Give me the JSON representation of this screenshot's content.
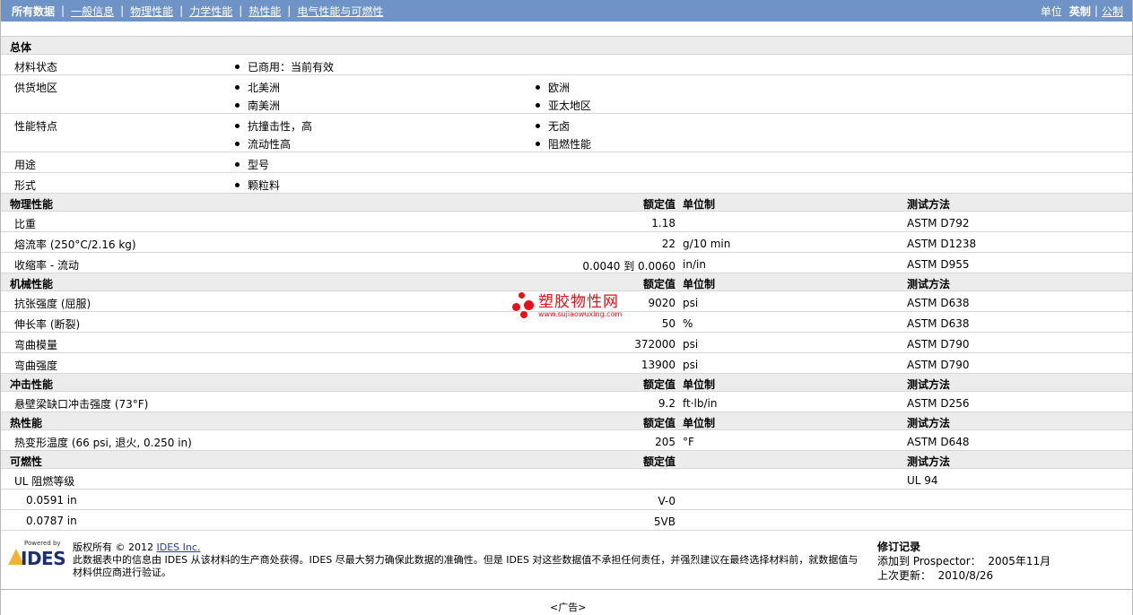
{
  "nav": {
    "tabs": [
      {
        "label": "所有数据",
        "active": true
      },
      {
        "label": "一般信息"
      },
      {
        "label": "物理性能"
      },
      {
        "label": "力学性能"
      },
      {
        "label": "热性能"
      },
      {
        "label": "电气性能与可燃性"
      }
    ],
    "units_label": "单位",
    "unit_current": "英制",
    "unit_other": "公制"
  },
  "general": {
    "title": "总体",
    "material_status_label": "材料状态",
    "material_status": "已商用：当前有效",
    "supply_label": "供货地区",
    "supply": [
      "北美洲",
      "欧洲",
      "南美洲",
      "亚太地区"
    ],
    "features_label": "性能特点",
    "features": [
      "抗撞击性，高",
      "无卤",
      "流动性高",
      "阻燃性能"
    ],
    "use_label": "用途",
    "use": "型号",
    "form_label": "形式",
    "form": "颗粒料"
  },
  "headers": {
    "rated": "额定值",
    "unit": "单位制",
    "test": "测试方法"
  },
  "sections": {
    "physical": {
      "title": "物理性能",
      "rows": [
        {
          "name": "比重",
          "value": "1.18",
          "unit": "",
          "test": "ASTM D792"
        },
        {
          "name": "熔流率 (250°C/2.16 kg)",
          "value": "22",
          "unit": "g/10 min",
          "test": "ASTM D1238"
        },
        {
          "name": "收缩率 - 流动",
          "value": "0.0040 到  0.0060",
          "unit": "in/in",
          "test": "ASTM D955"
        }
      ]
    },
    "mechanical": {
      "title": "机械性能",
      "rows": [
        {
          "name": "抗张强度 (屈服)",
          "value": "9020",
          "unit": "psi",
          "test": "ASTM D638"
        },
        {
          "name": "伸长率 (断裂)",
          "value": "50",
          "unit": "%",
          "test": "ASTM D638"
        },
        {
          "name": "弯曲模量",
          "value": "372000",
          "unit": "psi",
          "test": "ASTM D790"
        },
        {
          "name": "弯曲强度",
          "value": "13900",
          "unit": "psi",
          "test": "ASTM D790"
        }
      ]
    },
    "impact": {
      "title": "冲击性能",
      "rows": [
        {
          "name": "悬壁梁缺口冲击强度 (73°F)",
          "value": "9.2",
          "unit": "ft·lb/in",
          "test": "ASTM D256"
        }
      ]
    },
    "thermal": {
      "title": "热性能",
      "rows": [
        {
          "name": "热变形温度 (66 psi, 退火, 0.250 in)",
          "value": "205",
          "unit": "°F",
          "test": "ASTM D648"
        }
      ]
    },
    "flammability": {
      "title": "可燃性",
      "rows": [
        {
          "name": "UL 阻燃等级",
          "value": "",
          "unit": "",
          "test": "UL 94"
        },
        {
          "name": "0.0591 in",
          "value": "V-0",
          "unit": "",
          "test": ""
        },
        {
          "name": "0.0787 in",
          "value": "5VB",
          "unit": "",
          "test": ""
        }
      ]
    }
  },
  "watermark": {
    "name": "塑胶物性网",
    "url": "www.sujiaowuxing.com"
  },
  "footer": {
    "powered_by": "Powered by",
    "logo_text": "IDES",
    "copyright_prefix": "版权所有 © 2012",
    "copyright_link": "IDES Inc.",
    "disclaimer": "此数据表中的信息由  IDES 从该材料的生产商处获得。IDES 尽最大努力确保此数据的准确性。但是  IDES 对这些数据值不承担任何责任，并强烈建议在最终选择材料前，就数据值与材料供应商进行验证。",
    "revision_title": "修订记录",
    "added_label": "添加到 Prospector：",
    "added_value": "2005年11月",
    "updated_label": "上次更新：",
    "updated_value": "2010/8/26",
    "ad": "<广告>"
  }
}
